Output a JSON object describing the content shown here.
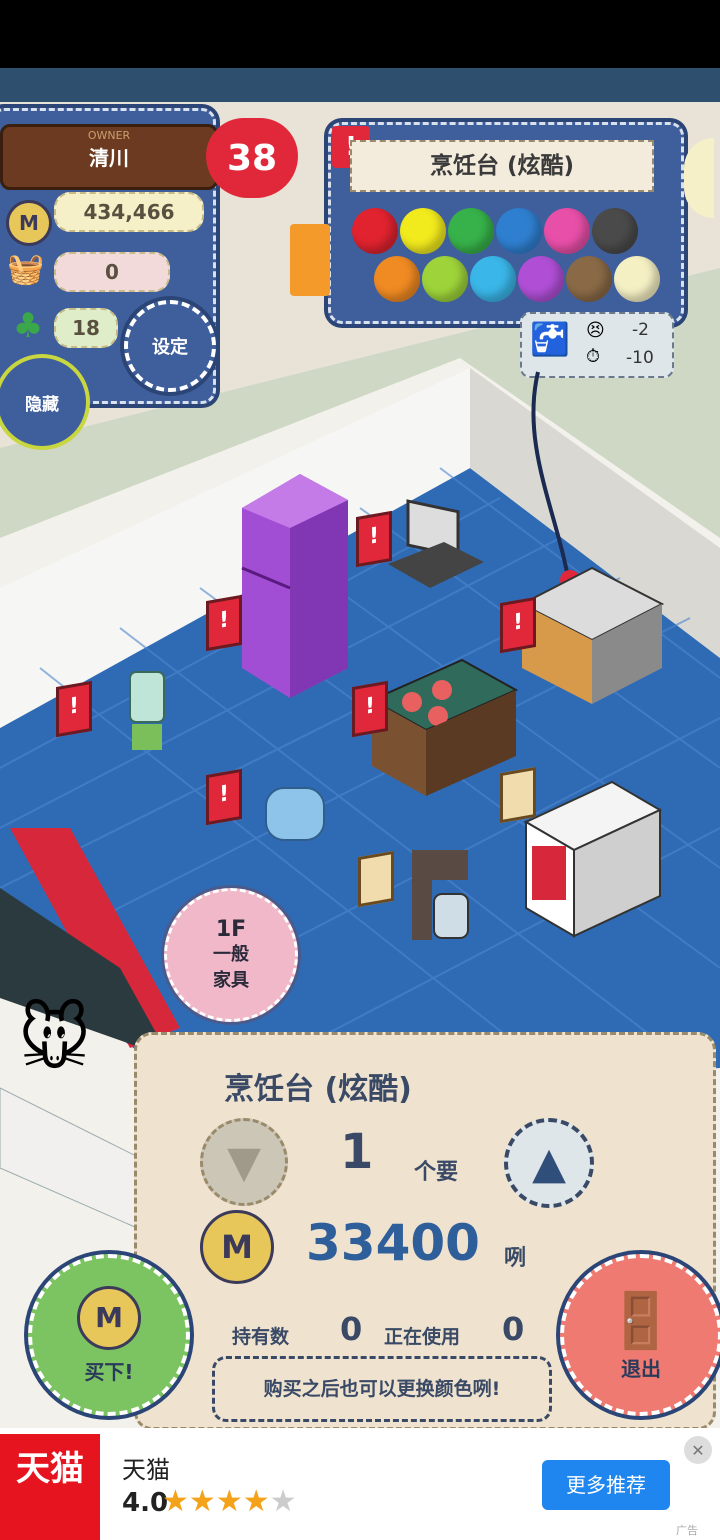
{
  "owner": {
    "label": "OWNER",
    "name": "清川"
  },
  "hearts": "38",
  "stats": {
    "money": "434,466",
    "basket": "0",
    "clover": "18"
  },
  "settings_label": "设定",
  "hide_label": "隐藏",
  "item_panel": {
    "alert": "!",
    "title": "烹饪台 (炫酷)",
    "colors": [
      "#e0232f",
      "#f1ea1d",
      "#37b24a",
      "#2f7fd0",
      "#e84fa8",
      "#4a4a4a",
      "#f08a22",
      "#9ed43a",
      "#3ab6e8",
      "#b04fd6",
      "#8a6a46",
      "#f5f0c4"
    ],
    "effects": {
      "mood": "-2",
      "time": "-10"
    }
  },
  "floor_bubble": {
    "floor": "1F",
    "type": "一般\n家具"
  },
  "purchase": {
    "name": "烹饪台 (炫酷)",
    "quantity": "1",
    "qty_unit": "个要",
    "price": "33400",
    "price_unit": "咧",
    "owned_label": "持有数",
    "owned": "0",
    "in_use_label": "正在使用",
    "in_use": "0",
    "hint": "购买之后也可以更换颜色咧!",
    "coin_symbol": "M"
  },
  "buy_label": "买下!",
  "exit_label": "退出",
  "ad": {
    "logo": "天猫",
    "name": "天猫",
    "rating": "4.0",
    "stars": 4,
    "cta": "更多推荐",
    "ad_tag": "广告"
  }
}
